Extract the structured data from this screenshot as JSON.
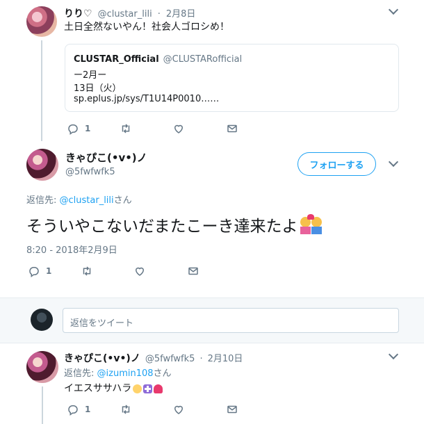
{
  "tweet1": {
    "name": "りり♡",
    "handle": "@clustar_lili",
    "dot": "·",
    "date": "2月8日",
    "text": "土日全然ないやん！社会人ゴロシめ！",
    "quote": {
      "name": "CLUSTAR_Official",
      "handle": "@CLUSTARofficial",
      "line1": "ー2月ー",
      "line2": "13日（火）",
      "line3": "sp.eplus.jp/sys/T1U14P0010……"
    },
    "reply_count": "1"
  },
  "main": {
    "name": "きゃぴこ(•v•)ノ",
    "handle": "@5fwfwfk5",
    "follow_label": "フォローする",
    "replying_prefix": "返信先: ",
    "replying_handle": "@clustar_lili",
    "replying_suffix": "さん",
    "text": "そういやこないだまたこーき達来たよ",
    "timestamp": "8:20 - 2018年2月9日",
    "reply_count": "1"
  },
  "reply_box": {
    "placeholder": "返信をツイート"
  },
  "tweet3": {
    "name": "きゃぴこ(•v•)ノ",
    "handle": "@5fwfwfk5",
    "dot": "·",
    "date": "2月10日",
    "replying_prefix": "返信先: ",
    "replying_handle": "@izumin108",
    "replying_suffix": "さん",
    "text": "イエスササハラ",
    "reply_count": "1"
  },
  "colors": {
    "accent": "#1da1f2",
    "muted": "#657786",
    "divider": "#e6ecf0"
  },
  "icons": [
    "chevron-down-icon",
    "reply-icon",
    "retweet-icon",
    "like-icon",
    "dm-icon",
    "angel-emoji",
    "cross-emoji",
    "heart-emoji",
    "couple-emoji"
  ]
}
